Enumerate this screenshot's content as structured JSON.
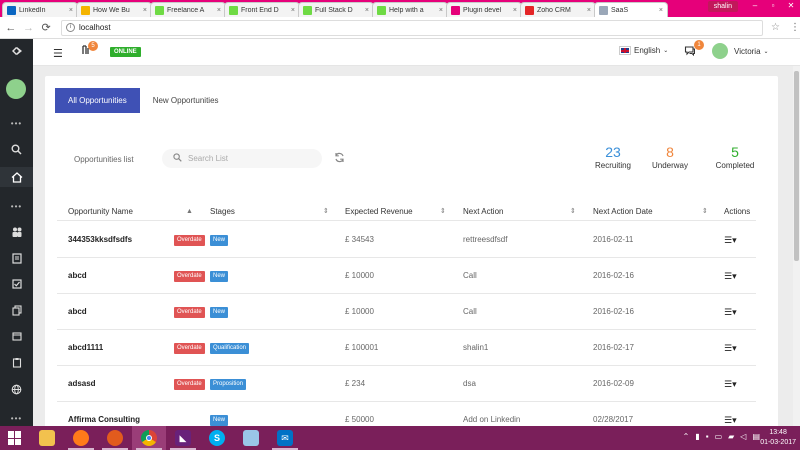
{
  "browser": {
    "tabs": [
      {
        "label": "LinkedIn",
        "favicon": "in",
        "color": "#0a66c2"
      },
      {
        "label": "How We Bu",
        "favicon": "doc",
        "color": "#f4b400"
      },
      {
        "label": "Freelance A",
        "favicon": "up",
        "color": "#6fda44"
      },
      {
        "label": "Front End D",
        "favicon": "up",
        "color": "#6fda44"
      },
      {
        "label": "Full Stack D",
        "favicon": "up",
        "color": "#6fda44"
      },
      {
        "label": "Help with a",
        "favicon": "up",
        "color": "#6fda44"
      },
      {
        "label": "Plugin devel",
        "favicon": "doc",
        "color": "#e6007a"
      },
      {
        "label": "Zoho CRM",
        "favicon": "zoho",
        "color": "#e42527"
      },
      {
        "label": "SaaS",
        "favicon": "page",
        "color": "#9aa7b8"
      }
    ],
    "profile_name": "shalin",
    "url": "localhost"
  },
  "app": {
    "notif_count": "5",
    "status": "ONLINE",
    "language": "English",
    "chat_count": "1",
    "user_name": "Victoria"
  },
  "page": {
    "tabs": [
      "All Opportunities",
      "New Opportunities"
    ],
    "list_label": "Opportunities list",
    "search_placeholder": "Search List",
    "stats": [
      {
        "value": "23",
        "label": "Recruiting",
        "color": "#3a8fd9"
      },
      {
        "value": "8",
        "label": "Underway",
        "color": "#f0863c"
      },
      {
        "value": "5",
        "label": "Completed",
        "color": "#2fae2c"
      }
    ],
    "columns": [
      "Opportunity Name",
      "Stages",
      "Expected Revenue",
      "Next Action",
      "Next Action Date",
      "Actions"
    ],
    "rows": [
      {
        "name": "344353kksdfsdfs",
        "overdue": "Overdate",
        "stage": "New",
        "revenue": "£ 34543",
        "next_action": "rettreesdfsdf",
        "date": "2016-02-11"
      },
      {
        "name": "abcd",
        "overdue": "Overdate",
        "stage": "New",
        "revenue": "£ 10000",
        "next_action": "Call",
        "date": "2016-02-16"
      },
      {
        "name": "abcd",
        "overdue": "Overdate",
        "stage": "New",
        "revenue": "£ 10000",
        "next_action": "Call",
        "date": "2016-02-16"
      },
      {
        "name": "abcd1111",
        "overdue": "Overdate",
        "stage": "Qualification",
        "revenue": "£ 100001",
        "next_action": "shalin1",
        "date": "2016-02-17"
      },
      {
        "name": "adsasd",
        "overdue": "Overdate",
        "stage": "Proposition",
        "revenue": "£ 234",
        "next_action": "dsa",
        "date": "2016-02-09"
      },
      {
        "name": "Affirma Consulting",
        "overdue": "",
        "stage": "New",
        "revenue": "£ 50000",
        "next_action": "Add on Linkedin",
        "date": "02/28/2017"
      }
    ]
  },
  "taskbar": {
    "time": "13:48",
    "date": "01-03-2017"
  }
}
